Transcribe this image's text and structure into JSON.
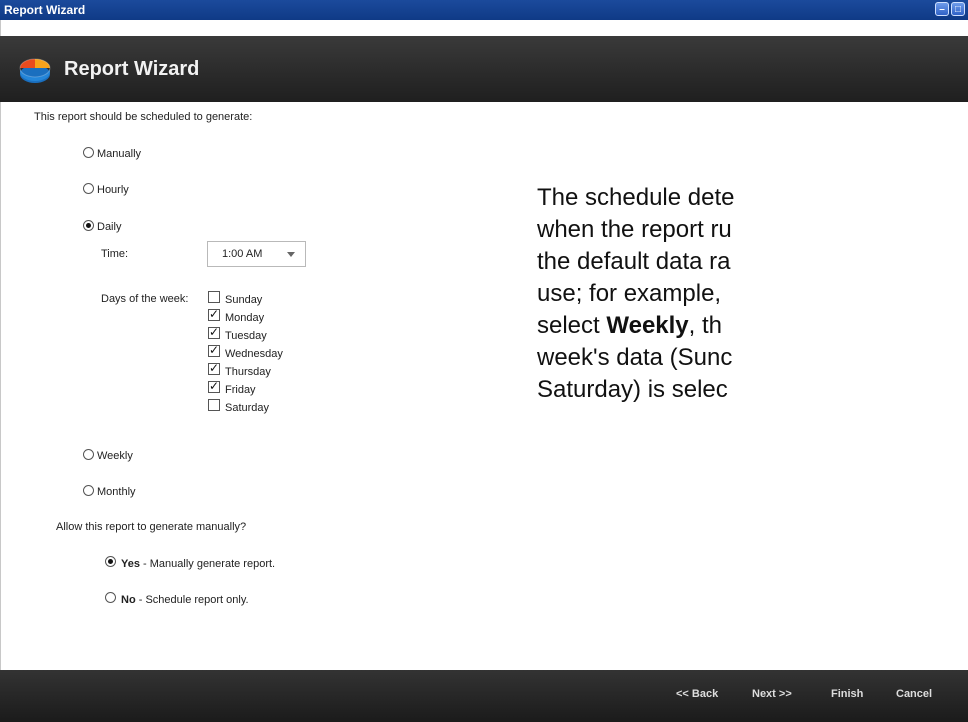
{
  "window": {
    "title": "Report Wizard"
  },
  "header": {
    "title": "Report Wizard"
  },
  "schedule": {
    "prompt": "This report should be scheduled to generate:",
    "options": {
      "manually": "Manually",
      "hourly": "Hourly",
      "daily": "Daily",
      "weekly": "Weekly",
      "monthly": "Monthly"
    },
    "selected": "Daily",
    "time_label": "Time:",
    "time_value": "1:00 AM",
    "days_label": "Days of the week:",
    "days": [
      {
        "label": "Sunday",
        "checked": false
      },
      {
        "label": "Monday",
        "checked": true
      },
      {
        "label": "Tuesday",
        "checked": true
      },
      {
        "label": "Wednesday",
        "checked": true
      },
      {
        "label": "Thursday",
        "checked": true
      },
      {
        "label": "Friday",
        "checked": true
      },
      {
        "label": "Saturday",
        "checked": false
      }
    ]
  },
  "manual": {
    "prompt": "Allow this report to generate manually?",
    "yes_bold": "Yes",
    "yes_rest": " - Manually generate report.",
    "no_bold": "No",
    "no_rest": " - Schedule report only.",
    "selected": "Yes"
  },
  "callout": {
    "line1": "The schedule dete",
    "line2": "when the report ru",
    "line3": "the default data ra",
    "line4": "use; for example,",
    "line5_pre": "select ",
    "line5_bold": "Weekly",
    "line5_post": ", th",
    "line6": "week's data (Sunc",
    "line7": "Saturday) is selec"
  },
  "footer": {
    "back": "<< Back",
    "next": "Next >>",
    "finish": "Finish",
    "cancel": "Cancel"
  }
}
